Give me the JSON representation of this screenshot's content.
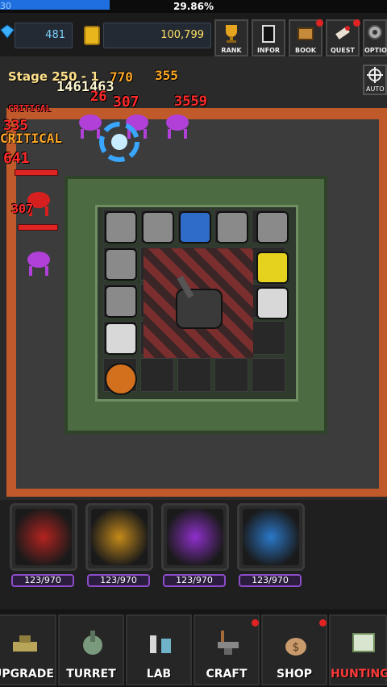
{
  "top_bar": {
    "level": "30",
    "progress_pct": 29.86,
    "progress_text": "29.86%"
  },
  "resources": {
    "gems": "481",
    "gold": "100,799"
  },
  "menu": [
    {
      "label": "RANK",
      "icon": "trophy-icon",
      "notify": false
    },
    {
      "label": "INFOR",
      "icon": "info-book-icon",
      "notify": false
    },
    {
      "label": "BOOK",
      "icon": "book-icon",
      "notify": true
    },
    {
      "label": "QUEST",
      "icon": "quest-scroll-icon",
      "notify": true
    },
    {
      "label": "OPTIO",
      "icon": "gear-icon",
      "notify": false
    }
  ],
  "auto_button": {
    "label": "AUTO"
  },
  "battle": {
    "stage": "Stage 250 - 1",
    "damage_texts": [
      "770",
      "355",
      "1461463",
      "26",
      "307",
      "3559",
      "CRITICAL",
      "335",
      "CRITICAL",
      "641",
      "307"
    ]
  },
  "skills": [
    {
      "name": "bullet-skill",
      "count": "123/970",
      "color": "#b3231f"
    },
    {
      "name": "target-skill",
      "count": "123/970",
      "color": "#c48a1a"
    },
    {
      "name": "arrow-skill",
      "count": "123/970",
      "color": "#8f2fcb"
    },
    {
      "name": "tornado-skill",
      "count": "123/970",
      "color": "#2a78c9"
    }
  ],
  "nav": [
    {
      "label": "UPGRADE",
      "icon": "tank-icon",
      "notify": false,
      "active": false
    },
    {
      "label": "TURRET",
      "icon": "turret-icon",
      "notify": false,
      "active": false
    },
    {
      "label": "LAB",
      "icon": "flask-icon",
      "notify": false,
      "active": false
    },
    {
      "label": "CRAFT",
      "icon": "anvil-icon",
      "notify": true,
      "active": false
    },
    {
      "label": "SHOP",
      "icon": "money-bag-icon",
      "notify": true,
      "active": false
    },
    {
      "label": "HUNTING",
      "icon": "map-icon",
      "notify": false,
      "active": true
    }
  ],
  "colors": {
    "accent_blue": "#1f6fe0",
    "gold": "#ffe063",
    "danger": "#ff2b2b",
    "track": "#c15a2a"
  }
}
